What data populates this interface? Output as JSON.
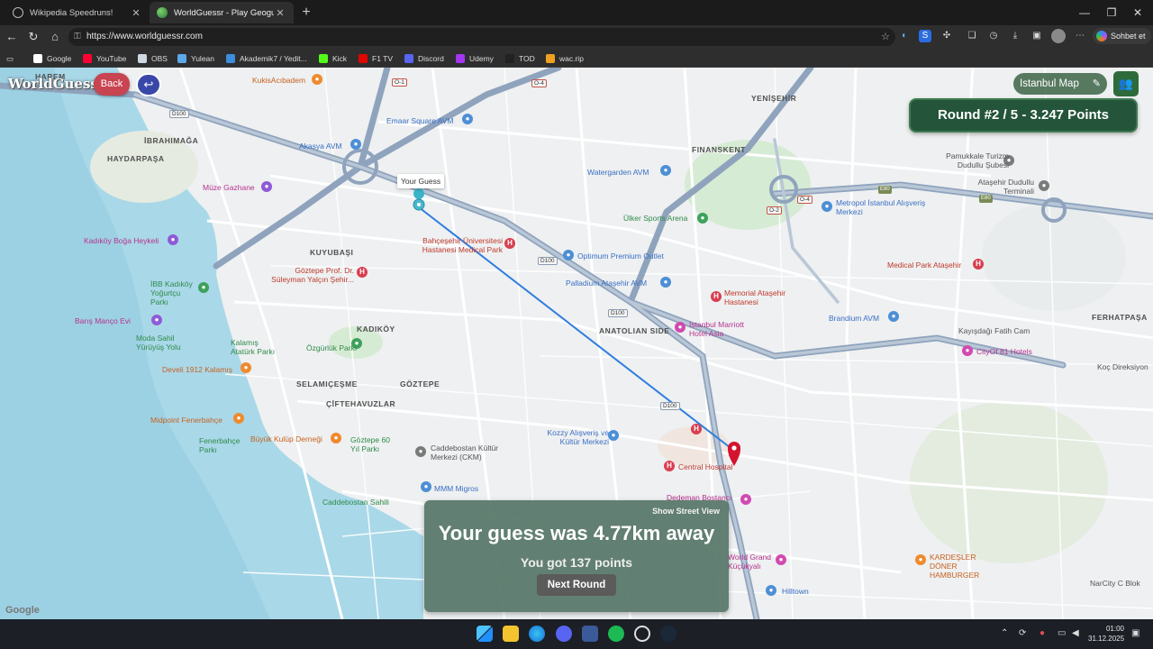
{
  "browser": {
    "tabs": [
      {
        "title": "Wikipedia Speedruns!",
        "close": "✕"
      },
      {
        "title": "WorldGuessr - Play Geoguessr for",
        "close": "✕"
      }
    ],
    "new_tab": "+",
    "window_controls": {
      "minimize": "—",
      "maximize": "❐",
      "close": "✕"
    },
    "url": "https://www.worldguessr.com",
    "copilot_label": "Sohbet et",
    "bookmarks": [
      {
        "label": "Google",
        "color": "#ffffff"
      },
      {
        "label": "YouTube",
        "color": "#ff0033"
      },
      {
        "label": "OBS",
        "color": "#cfd8e3"
      },
      {
        "label": "Yulean",
        "color": "#5da9e9"
      },
      {
        "label": "Akademik7 / Yedit...",
        "color": "#3c8dde"
      },
      {
        "label": "Kick",
        "color": "#53fc18"
      },
      {
        "label": "F1 TV",
        "color": "#e10600"
      },
      {
        "label": "Discord",
        "color": "#5865f2"
      },
      {
        "label": "Udemy",
        "color": "#a435f0"
      },
      {
        "label": "TOD",
        "color": "#222222"
      },
      {
        "label": "wac.rip",
        "color": "#f0a020"
      }
    ]
  },
  "game": {
    "logo": "WorldGuessr",
    "back_label": "Back",
    "undo_icon": "↩",
    "map_name": "Istanbul Map",
    "round_text": "Round #2 / 5 - 3.247 Points",
    "guess_tag": "Your Guess",
    "result": {
      "street_view_label": "Show Street View",
      "headline": "Your guess was 4.77km away",
      "points_text": "You got 137 points",
      "next_label": "Next Round"
    },
    "google_watermark": "Google"
  },
  "map": {
    "districts": [
      "HAREM",
      "İBRAHIMAĞA",
      "HAYDARPAŞA",
      "KUYUBAŞI",
      "KADIKÖY",
      "SELAMIÇEŞME",
      "ÇİFTEHAVUZLAR",
      "GÖZTEPE",
      "ANATOLIAN SIDE",
      "FINANSKENT",
      "YENİŞEHİR",
      "FERHATPAŞA"
    ],
    "pois": [
      "KukisAcıbadem",
      "Emaar Square AVM",
      "Akasya AVM",
      "Müze Gazhane",
      "Watergarden AVM",
      "Ülker Sports Arena",
      "Metropol İstanbul Alışveriş Merkezi",
      "Pamukkale Turizm Dudullu Şubesi",
      "Ataşehir Dudullu Terminali",
      "Kadıköy Boğa Heykeli",
      "İBB Kadıköy Yoğurtçu Parkı",
      "Göztepe Prof. Dr. Süleyman Yalçın Şehir...",
      "Bahçeşehir Üniversitesi Hastanesi Medical Park",
      "Optimum Premium Outlet",
      "Palladium Ataşehir AVM",
      "Memorial Ataşehir Hastanesi",
      "Medical Park Ataşehir",
      "İstanbul Marriott Hotel Asia",
      "Brandium AVM",
      "Barış Manço Evi",
      "Moda Sahil Yürüyüş Yolu",
      "Kalamış Atatürk Parkı",
      "Develi 1912 Kalamış",
      "Özgürlük Parkı",
      "CityOf 81 Hotels",
      "Kayışdağı Fatih Cam",
      "Koç Direksiyon",
      "Midpoint Fenerbahçe",
      "Fenerbahçe Parkı",
      "Büyük Kulüp Derneği",
      "Göztepe 60 Yıl Parkı",
      "Caddebostan Kültür Merkezi (CKM)",
      "Kozzy Alışveriş ve Kültür Merkezi",
      "Central Hospital",
      "Dedeman Bostancı",
      "MMM Migros",
      "Caddebostan Sahili",
      "World Grand Küçükyalı",
      "Hilltown",
      "KARDEŞLER DÖNER HAMBURGER",
      "NarCity C Blok"
    ],
    "road_signs": [
      "D100",
      "D100",
      "D100",
      "D100",
      "O-1",
      "O-4",
      "O-2",
      "O-4",
      "E80",
      "E80"
    ]
  },
  "taskbar": {
    "clock_time": "01:00",
    "clock_date": "31.12.2025"
  },
  "colors": {
    "back": "#c84450",
    "undo": "#3948a8",
    "round_bg": "#24553a",
    "result_bg": "#4d6e60",
    "guess_line": "#2e7de0",
    "actual_pin": "#d4142f"
  }
}
